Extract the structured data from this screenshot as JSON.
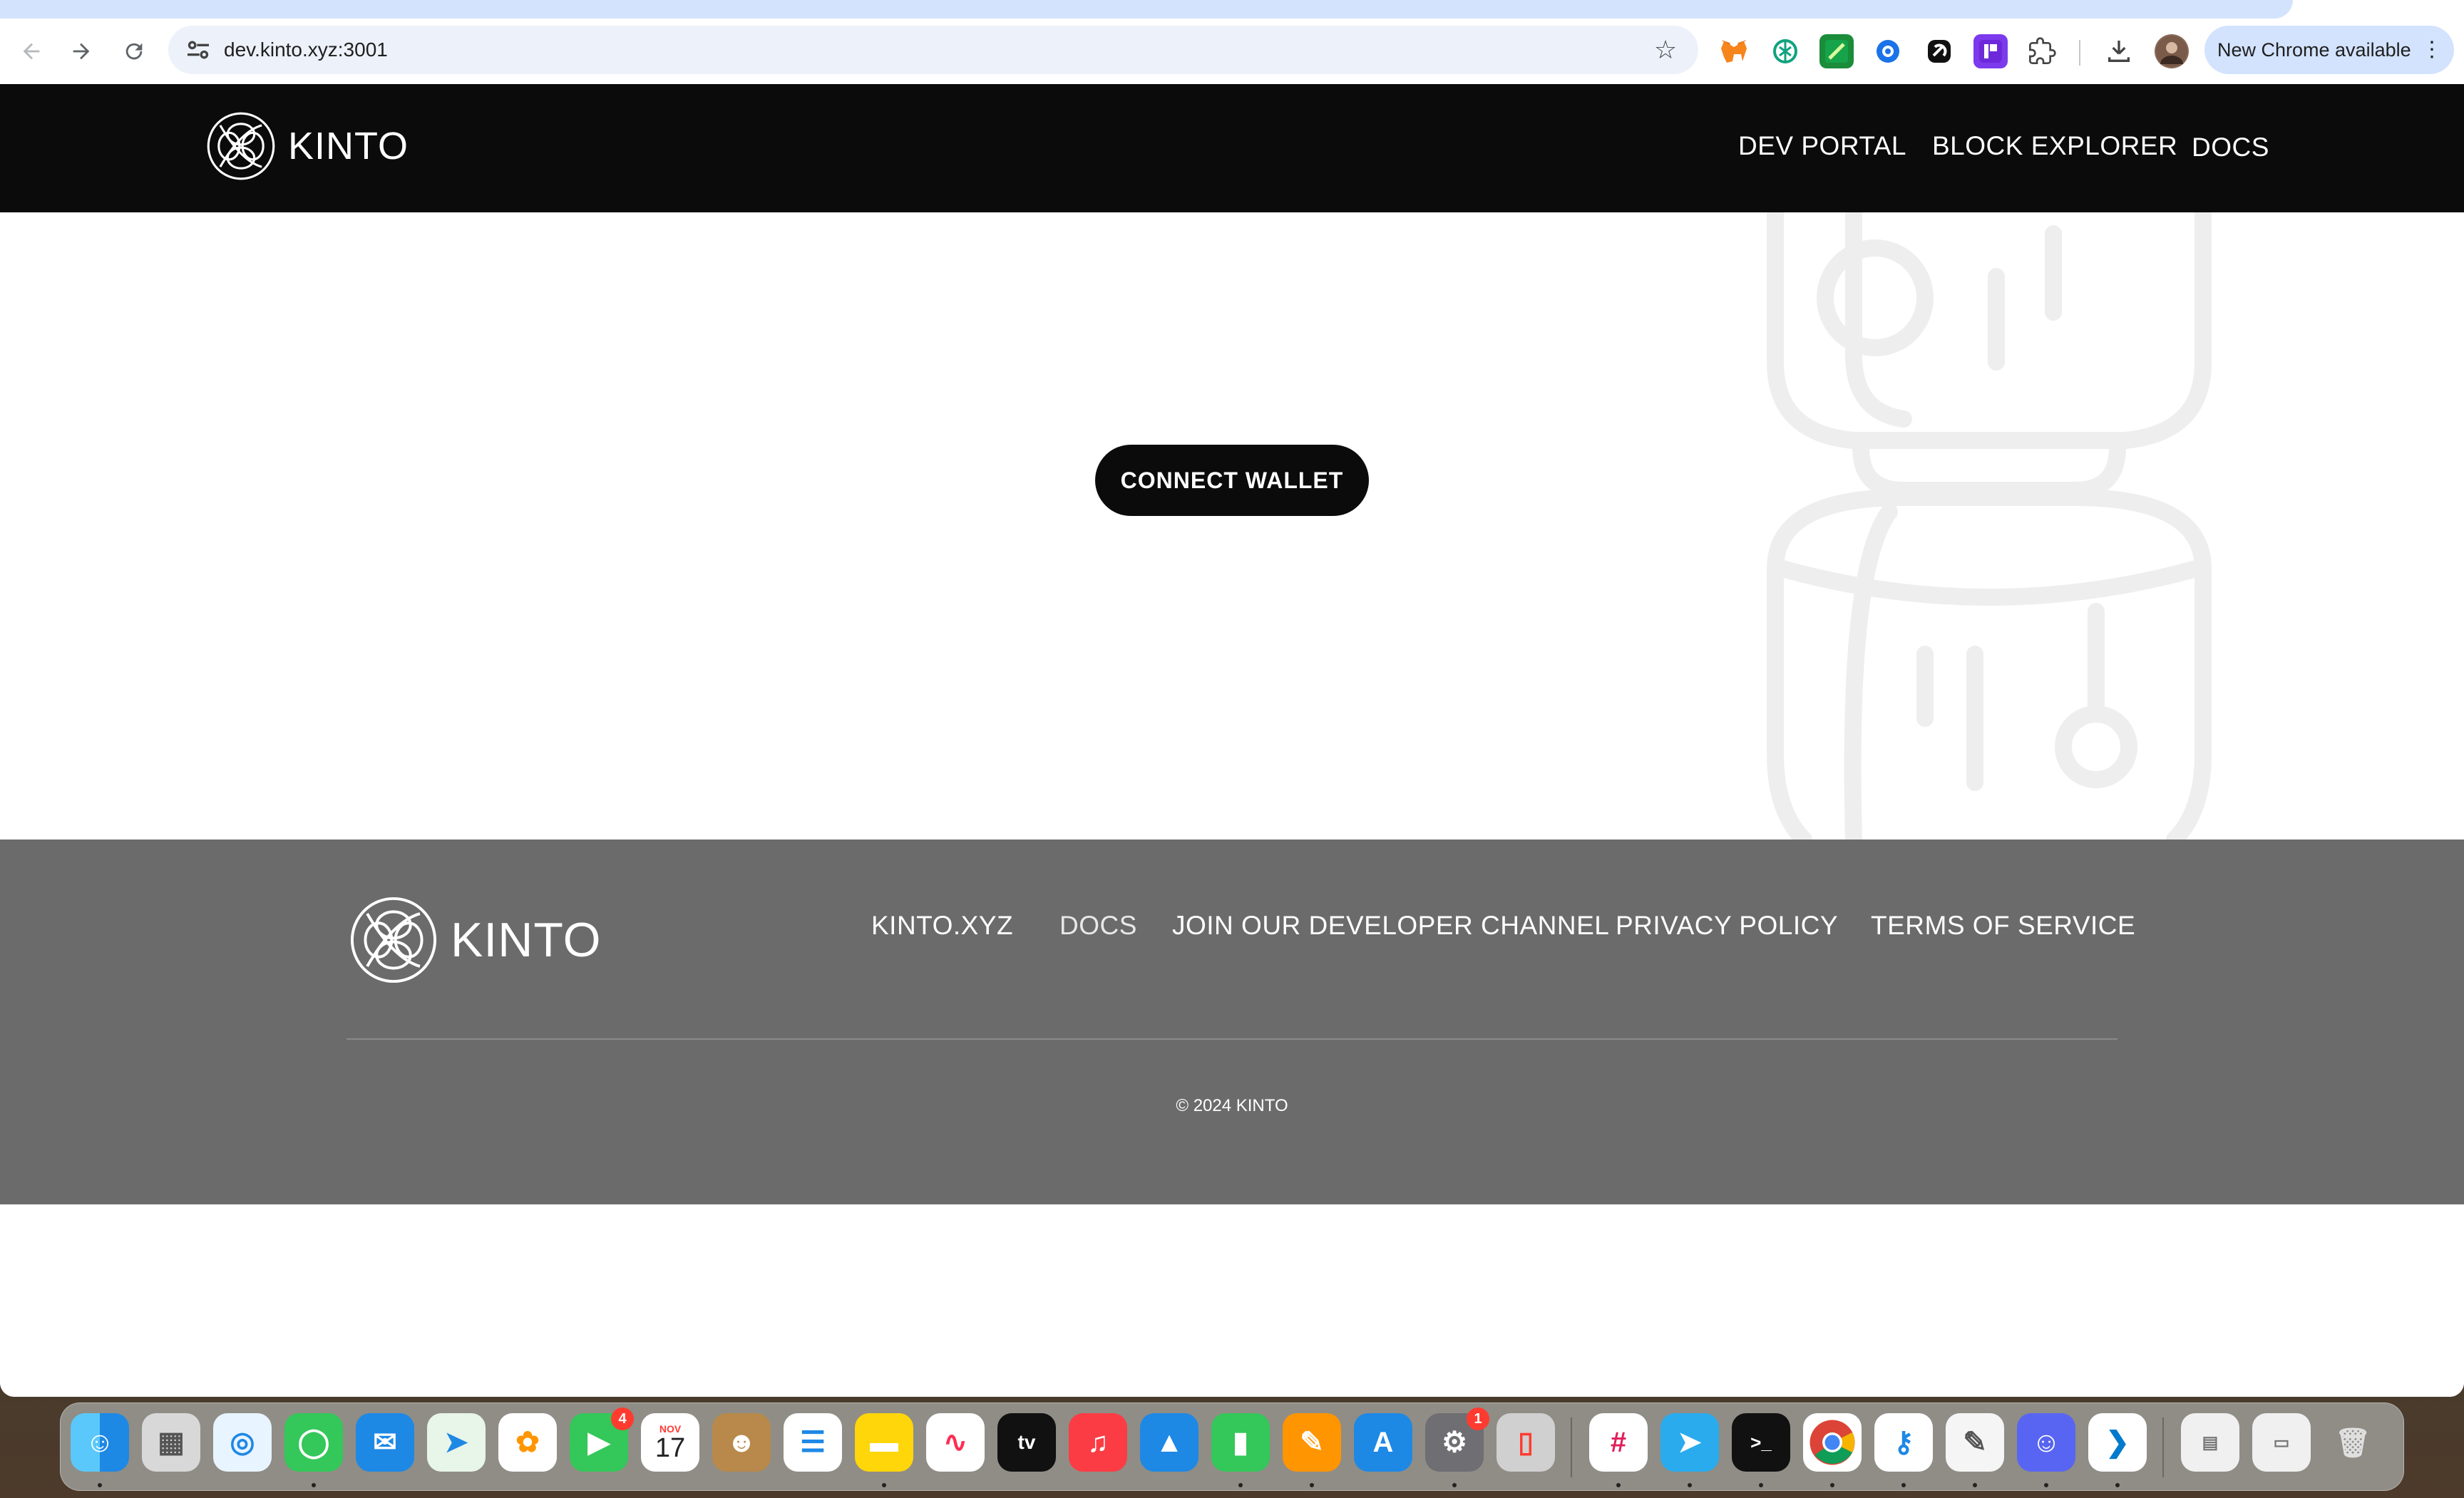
{
  "browser": {
    "url": "dev.kinto.xyz:3001",
    "update_chip_label": "New Chrome available",
    "icons": {
      "back": "arrow-left-icon",
      "forward": "arrow-right-icon",
      "reload": "reload-icon",
      "site_info": "tune-icon",
      "bookmark": "star-icon",
      "extensions": "puzzle-icon",
      "downloads": "download-icon",
      "menu": "more-vert-icon"
    }
  },
  "header": {
    "logo_text": "KINTO",
    "nav": [
      "DEV PORTAL",
      "BLOCK EXPLORER",
      "DOCS"
    ]
  },
  "hero": {
    "connect_label": "CONNECT WALLET"
  },
  "footer": {
    "logo_text": "KINTO",
    "links": [
      "KINTO.XYZ",
      "DOCS",
      "JOIN OUR DEVELOPER CHANNEL",
      "PRIVACY POLICY",
      "TERMS OF SERVICE"
    ],
    "copyright": "© 2024 KINTO"
  },
  "dock": {
    "calendar_month": "NOV",
    "calendar_day": "17",
    "tv_label": "tv",
    "facetime_badge": "4",
    "settings_badge": "1"
  },
  "colors": {
    "header_bg": "#0b0b0b",
    "footer_bg": "#6b6b6b",
    "button_bg": "#0b0b0b",
    "omnibox_bg": "#edf2fa",
    "chip_bg": "#d3e3fd"
  }
}
